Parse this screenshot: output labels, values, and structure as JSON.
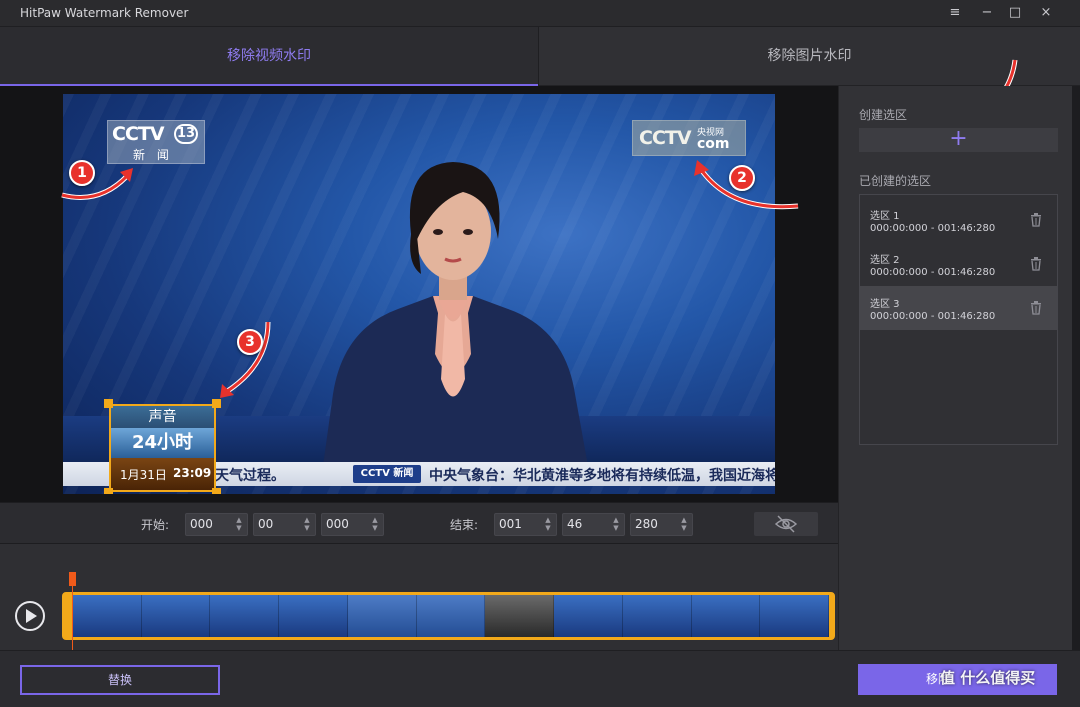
{
  "app": {
    "title": "HitPaw Watermark Remover",
    "window_controls": [
      "≡",
      "−",
      "□",
      "×"
    ]
  },
  "tabs": [
    {
      "label": "移除视频水印",
      "active": true
    },
    {
      "label": "移除图片水印",
      "active": false
    }
  ],
  "video": {
    "logo_left": {
      "brand": "CCTV",
      "channel": "13",
      "sub": "新 闻"
    },
    "logo_right": {
      "brand": "CCTV",
      "sub": "央视网",
      "suffix": "com"
    },
    "ticker": {
      "text_left": "雪冰冻天气过程。",
      "badge": "CCTV 新闻",
      "text_right": "中央气象台：华北黄淮等多地将有持续低温，我国近海将"
    },
    "program_box": {
      "line1": "声音",
      "line2": "24小时",
      "date": "1月31日",
      "time": "23:09"
    },
    "markers": [
      "1",
      "2",
      "3"
    ]
  },
  "time_controls": {
    "start_label": "开始:",
    "start": [
      "000",
      "00",
      "000"
    ],
    "end_label": "结束:",
    "end": [
      "001",
      "46",
      "280"
    ]
  },
  "sidebar": {
    "create_label": "创建选区",
    "add_symbol": "+",
    "created_label": "已创建的选区",
    "regions": [
      {
        "name": "选区 1",
        "range": "000:00:000 - 001:46:280",
        "selected": false
      },
      {
        "name": "选区 2",
        "range": "000:00:000 - 001:46:280",
        "selected": false
      },
      {
        "name": "选区 3",
        "range": "000:00:000 - 001:46:280",
        "selected": true
      }
    ]
  },
  "bottom": {
    "replace_label": "替换",
    "remove_label": "移除",
    "watermark_text": "值 什么值得买"
  },
  "colors": {
    "accent": "#7a66e8",
    "selection": "#f2a91a",
    "marker": "#e8322c"
  }
}
